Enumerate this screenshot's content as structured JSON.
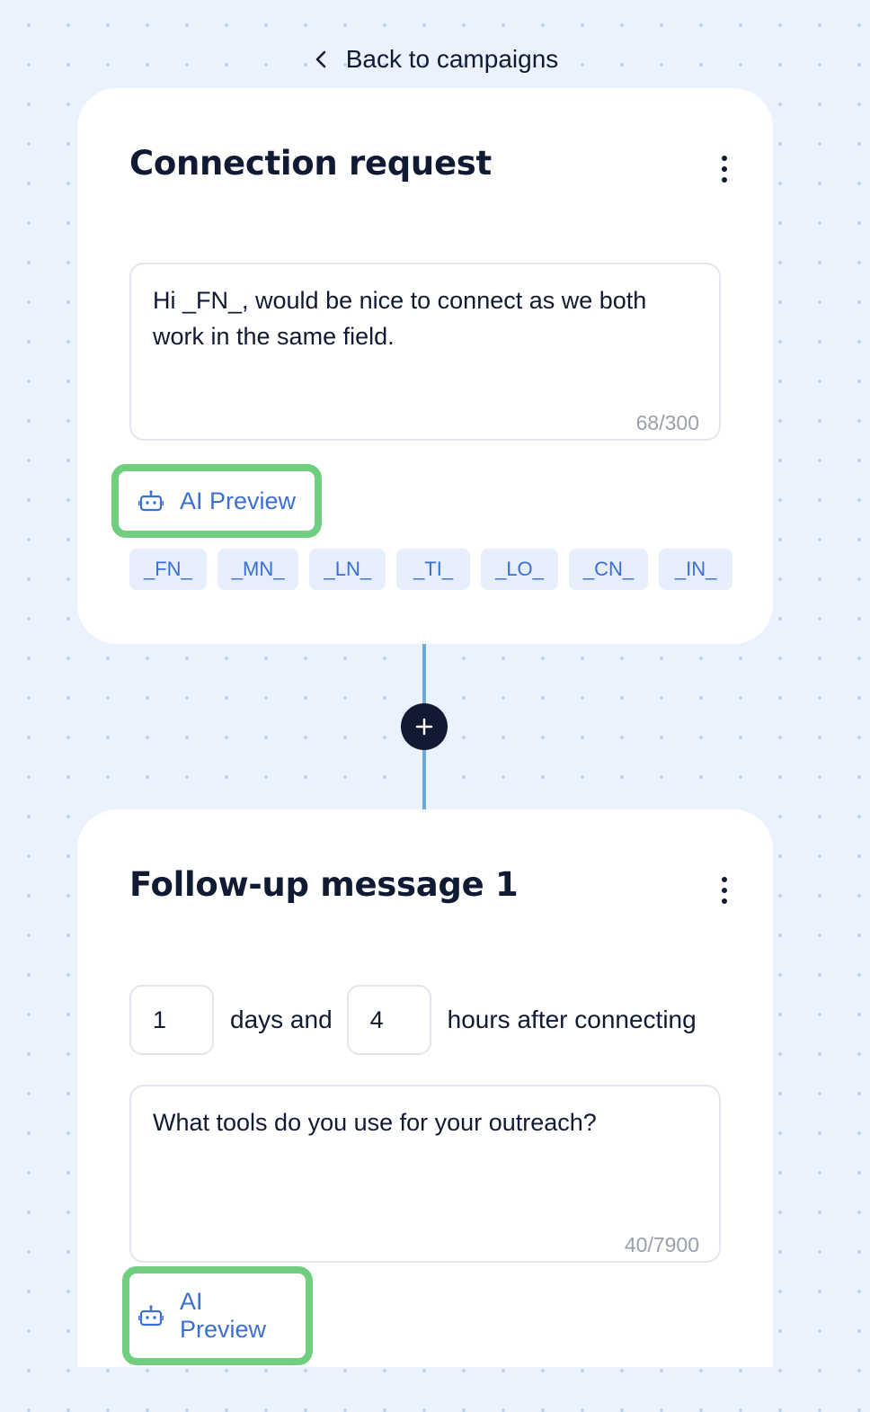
{
  "nav": {
    "back_label": "Back to campaigns"
  },
  "connection_card": {
    "title": "Connection request",
    "message": "Hi _FN_, would be nice to connect as we both work in the same field.",
    "char_count": "68/300",
    "ai_preview_label": "AI Preview",
    "tags": [
      "_FN_",
      "_MN_",
      "_LN_",
      "_TI_",
      "_LO_",
      "_CN_",
      "_IN_"
    ]
  },
  "followup_card": {
    "title": "Follow-up message 1",
    "days_value": "1",
    "days_label": "days and",
    "hours_value": "4",
    "hours_label": "hours after connecting",
    "message": "What tools do you use for your outreach?",
    "char_count": "40/7900",
    "ai_preview_label": "AI Preview"
  },
  "icons": {
    "back": "chevron-left-icon",
    "menu": "kebab-menu-icon",
    "ai": "robot-icon",
    "add": "plus-icon"
  },
  "colors": {
    "accent": "#3b6fd6",
    "highlight": "#6fcf7f",
    "dark": "#111a33",
    "tag_bg": "#e6eefb",
    "connector": "#6eaad9"
  }
}
